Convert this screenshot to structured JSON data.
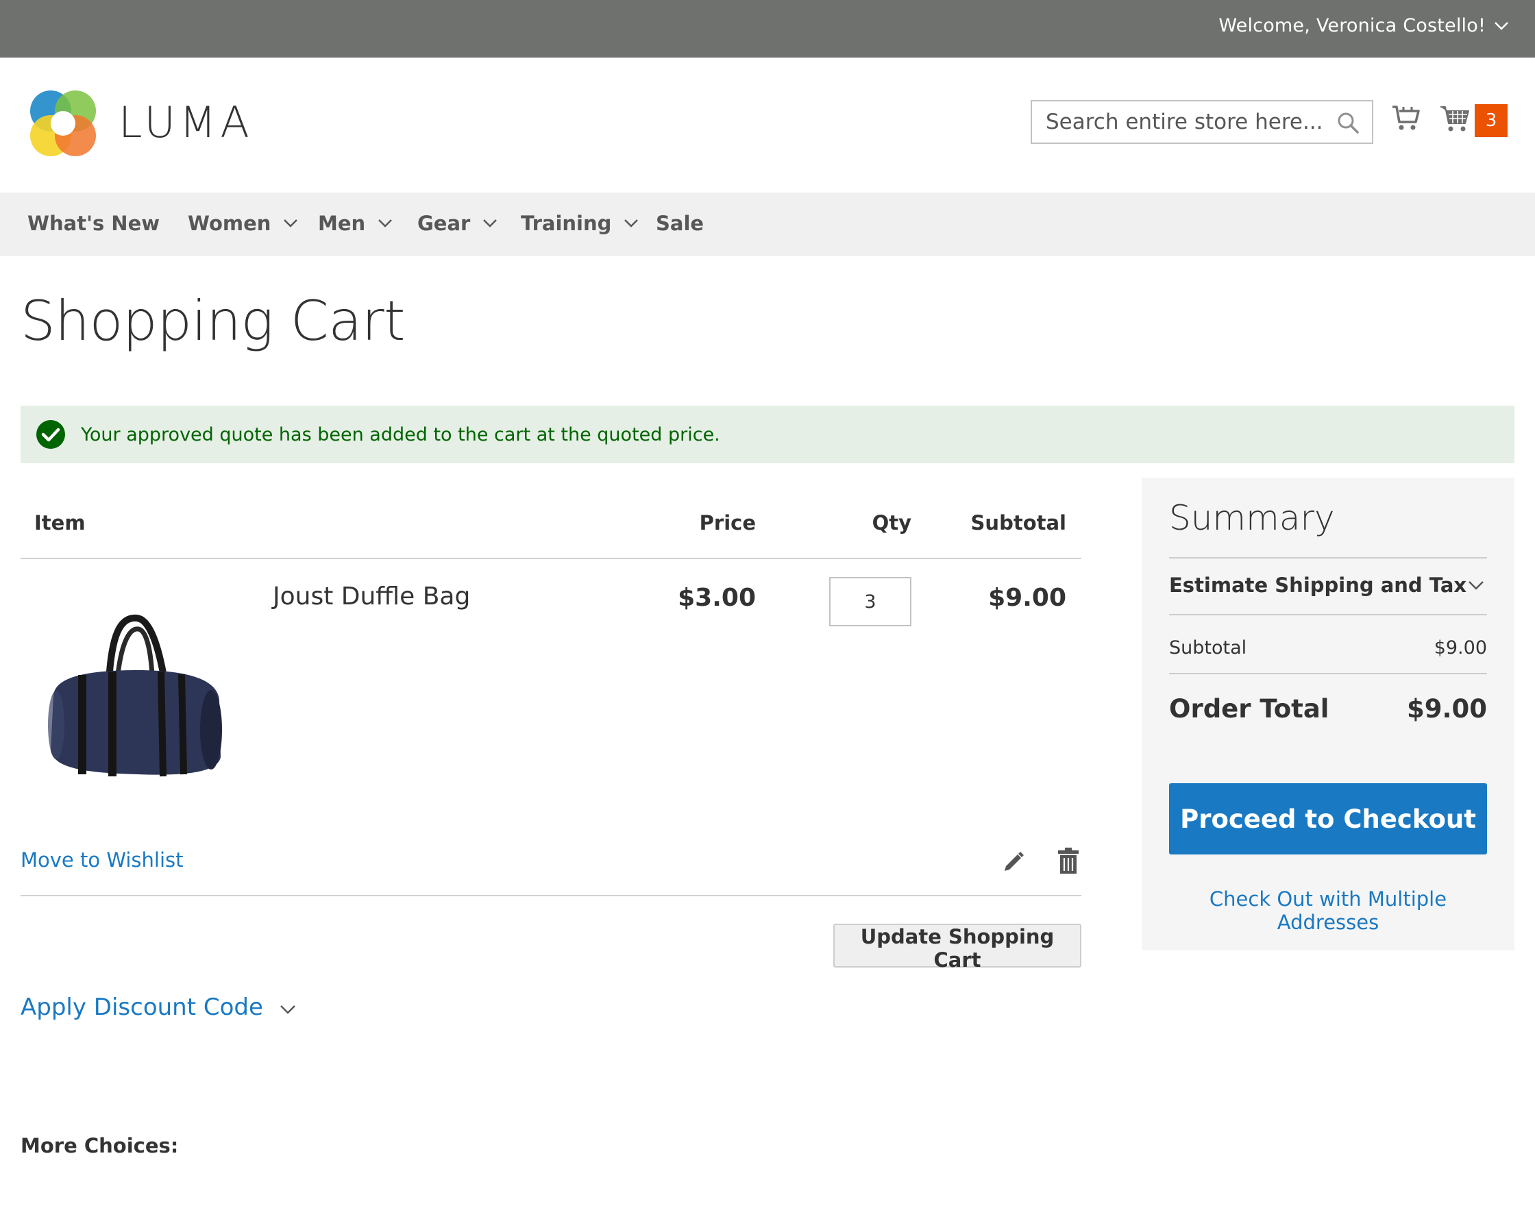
{
  "top_panel": {
    "welcome": "Welcome, Veronica Costello!"
  },
  "header": {
    "logo_text": "LUMA",
    "search_placeholder": "Search entire store here...",
    "cart_count": "3"
  },
  "nav": {
    "items": [
      {
        "label": "What's New",
        "has_dropdown": false
      },
      {
        "label": "Women",
        "has_dropdown": true
      },
      {
        "label": "Men",
        "has_dropdown": true
      },
      {
        "label": "Gear",
        "has_dropdown": true
      },
      {
        "label": "Training",
        "has_dropdown": true
      },
      {
        "label": "Sale",
        "has_dropdown": false
      }
    ]
  },
  "page": {
    "title": "Shopping Cart"
  },
  "message": {
    "text": "Your approved quote has been added to the cart at the quoted price."
  },
  "cart": {
    "headers": {
      "item": "Item",
      "price": "Price",
      "qty": "Qty",
      "subtotal": "Subtotal"
    },
    "items": [
      {
        "name": "Joust Duffle Bag",
        "price": "$3.00",
        "qty": "3",
        "subtotal": "$9.00"
      }
    ],
    "move_to_wishlist": "Move to Wishlist",
    "update_label": "Update Shopping Cart",
    "discount_label": "Apply Discount Code",
    "more_choices": "More Choices:"
  },
  "summary": {
    "title": "Summary",
    "estimate_label": "Estimate Shipping and Tax",
    "subtotal_label": "Subtotal",
    "subtotal_value": "$9.00",
    "order_total_label": "Order Total",
    "order_total_value": "$9.00",
    "checkout_label": "Proceed to Checkout",
    "multi_address_label": "Check Out with Multiple Addresses"
  },
  "colors": {
    "accent": "#1979c3",
    "badge": "#eb5202",
    "top_bar": "#6e716e",
    "success_bg": "#e5efe5",
    "success_text": "#006400"
  },
  "icons": [
    "chevron-down-icon",
    "search-icon",
    "compare-icon",
    "cart-icon",
    "check-circle-icon",
    "edit-icon",
    "trash-icon"
  ]
}
